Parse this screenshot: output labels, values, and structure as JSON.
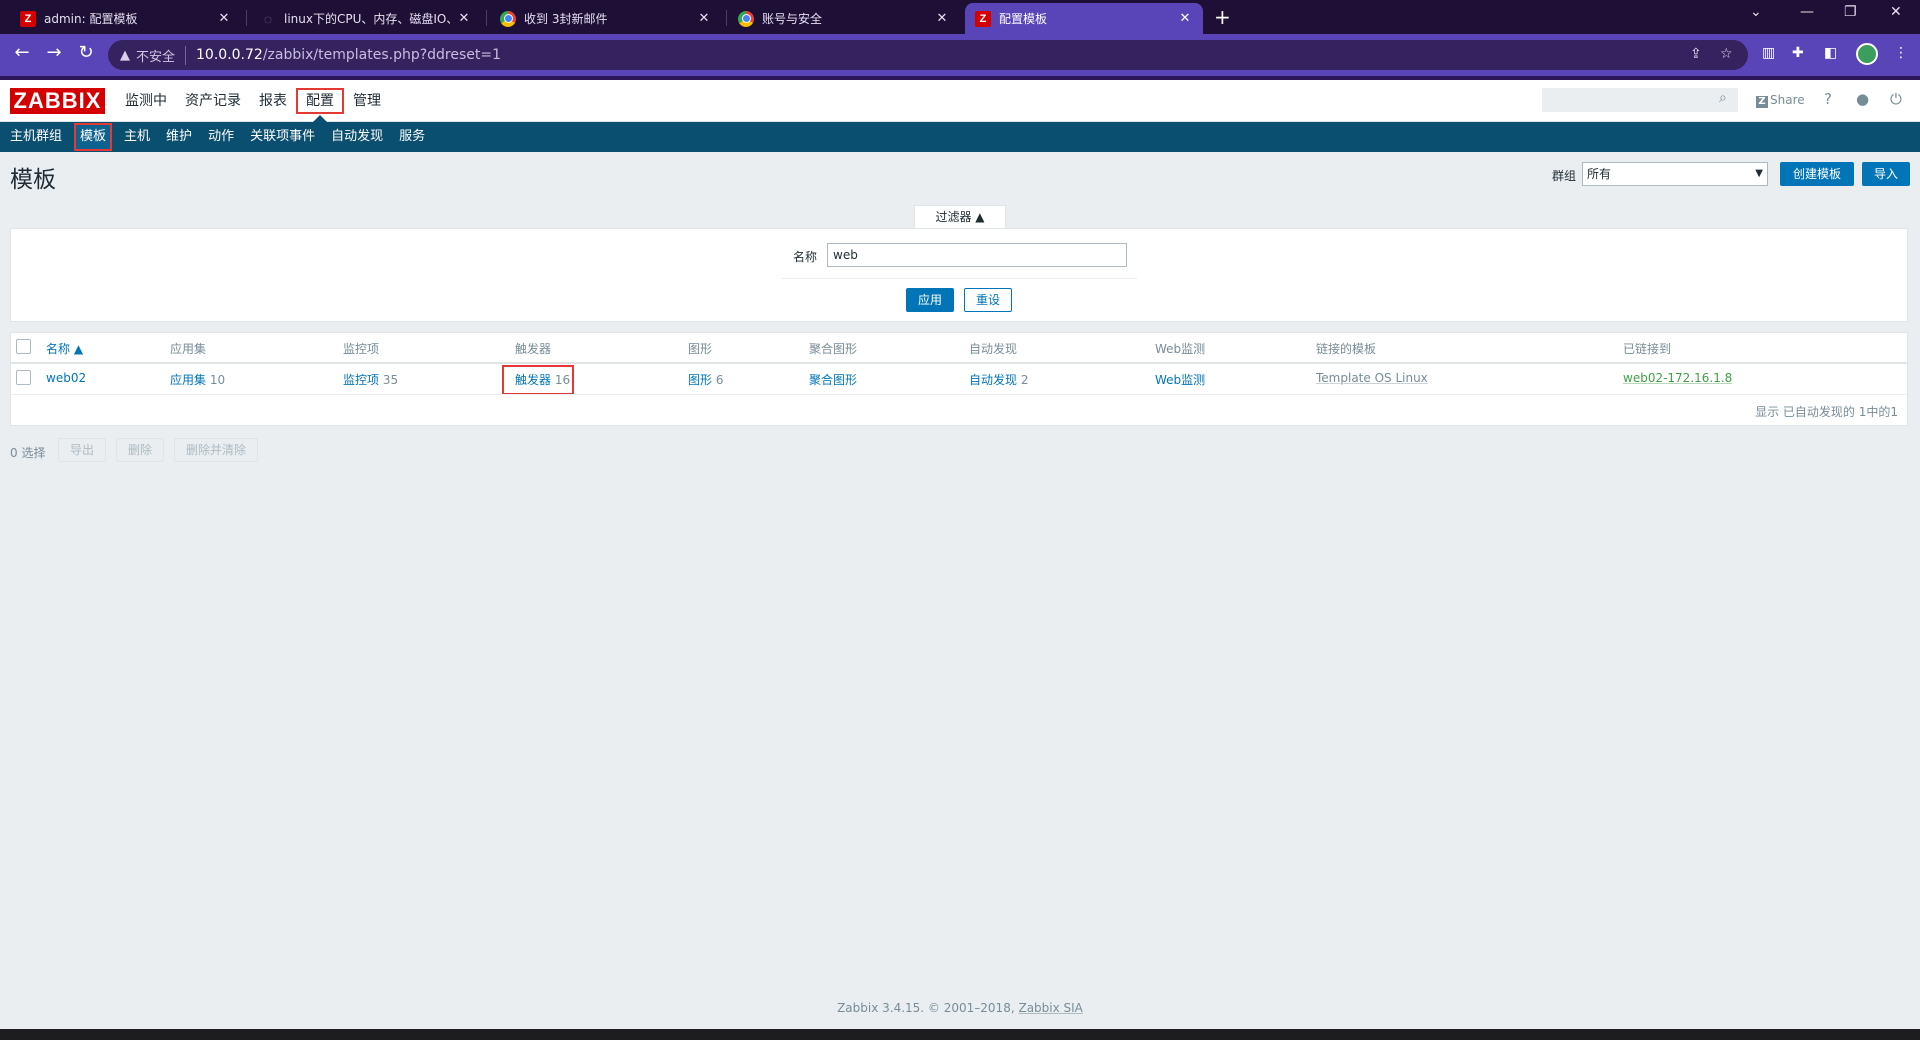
{
  "browser": {
    "tabs": [
      {
        "title": "admin: 配置模板",
        "favicon": "zabbix-icon"
      },
      {
        "title": "linux下的CPU、内存、磁盘IO、",
        "favicon": "spinner-icon"
      },
      {
        "title": "收到 3封新邮件",
        "favicon": "chrome-icon"
      },
      {
        "title": "账号与安全",
        "favicon": "chrome-icon"
      },
      {
        "title": "配置模板",
        "favicon": "zabbix-icon"
      }
    ],
    "insecure_label": "不安全",
    "url_host": "10.0.0.72",
    "url_path": "/zabbix/templates.php?ddreset=1"
  },
  "header": {
    "logo": "ZABBIX",
    "menu": [
      "监测中",
      "资产记录",
      "报表",
      "配置",
      "管理"
    ],
    "share_label": "Share"
  },
  "submenu": [
    "主机群组",
    "模板",
    "主机",
    "维护",
    "动作",
    "关联项事件",
    "自动发现",
    "服务"
  ],
  "page": {
    "title": "模板",
    "group_label": "群组",
    "group_value": "所有",
    "create_button": "创建模板",
    "import_button": "导入"
  },
  "filter": {
    "tab_label": "过滤器 ▲",
    "name_label": "名称",
    "name_value": "web",
    "apply": "应用",
    "reset": "重设"
  },
  "table": {
    "columns": [
      "名称 ▲",
      "应用集",
      "监控项",
      "触发器",
      "图形",
      "聚合图形",
      "自动发现",
      "Web监测",
      "链接的模板",
      "已链接到"
    ],
    "row": {
      "name": "web02",
      "apps": "应用集",
      "apps_count": "10",
      "items": "监控项",
      "items_count": "35",
      "triggers": "触发器",
      "triggers_count": "16",
      "graphs": "图形",
      "graphs_count": "6",
      "screens": "聚合图形",
      "discovery": "自动发现",
      "discovery_count": "2",
      "web": "Web监测",
      "linked_templates": "Template OS Linux",
      "linked_to": "web02-172.16.1.8"
    },
    "paging": "显示 已自动发现的 1中的1"
  },
  "actions": {
    "selected": "0 选择",
    "export": "导出",
    "delete": "删除",
    "delete_clear": "删除并清除"
  },
  "footer": {
    "text": "Zabbix 3.4.15. © 2001–2018, ",
    "link": "Zabbix SIA"
  },
  "colors": {
    "accent": "#0275b8",
    "submenu_bg": "#0b4f70",
    "logo_red": "#d40000",
    "highlight_red": "#e53935",
    "linked_green": "#429e47"
  }
}
